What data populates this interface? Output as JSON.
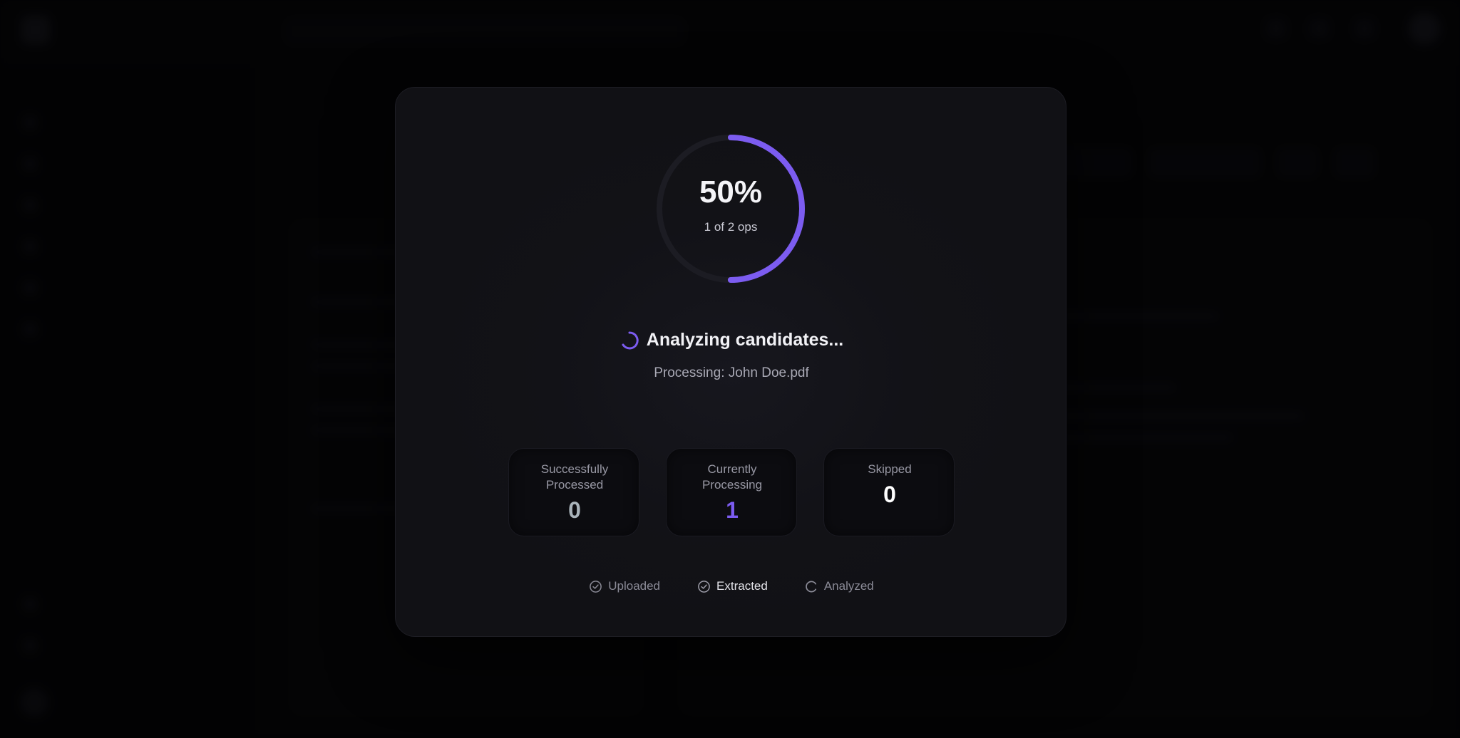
{
  "app": {
    "name": "",
    "search_placeholder": ""
  },
  "modal": {
    "progress": {
      "percent_label": "50%",
      "percent_value": 0.5,
      "ops_label": "1 of 2 ops",
      "ring_color": "#7c5cf0"
    },
    "status": {
      "title": "Analyzing candidates...",
      "file": "Processing: John Doe.pdf",
      "spinner_icon": "spinner-icon"
    },
    "stats": [
      {
        "label": "Successfully Processed",
        "value": "0",
        "color": "#a9b3ba"
      },
      {
        "label": "Currently Processing",
        "value": "1",
        "color": "#7c5cf0"
      },
      {
        "label": "Skipped",
        "value": "0",
        "color": "#ffffff"
      }
    ],
    "steps": [
      {
        "label": "Uploaded",
        "state": "done",
        "icon": "check-circle-icon"
      },
      {
        "label": "Extracted",
        "state": "done",
        "icon": "check-circle-icon"
      },
      {
        "label": "Analyzed",
        "state": "in-progress",
        "icon": "loading-icon"
      }
    ]
  },
  "colors": {
    "accent": "#7c5cf0",
    "modal_bg": "#121217",
    "overlay": "#000000"
  }
}
